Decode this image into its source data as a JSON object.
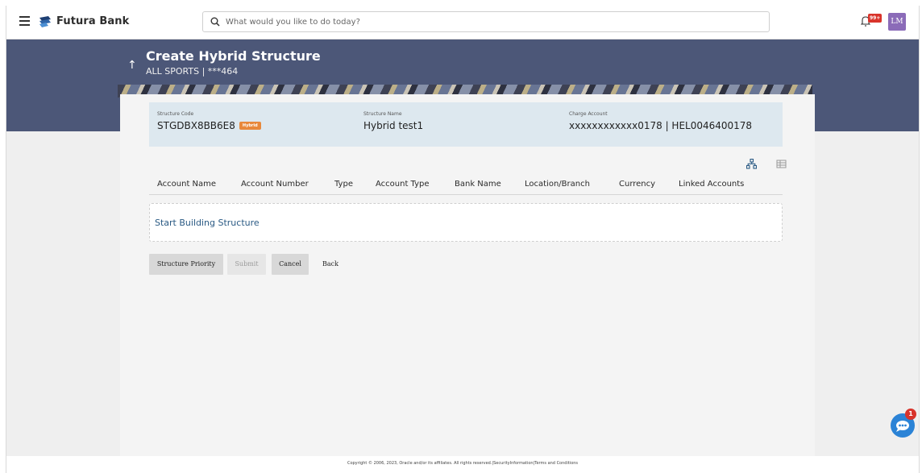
{
  "app": {
    "brand": "Futura Bank"
  },
  "search": {
    "placeholder": "What would you like to do today?"
  },
  "notifications": {
    "badge": "99+"
  },
  "user": {
    "initials": "LM"
  },
  "page": {
    "title": "Create Hybrid Structure",
    "subtitle": "ALL SPORTS | ***464"
  },
  "structure": {
    "code_label": "Structure Code",
    "code": "STGDBX8BB6E8",
    "tag": "Hybrid",
    "name_label": "Structure Name",
    "name": "Hybrid test1",
    "charge_label": "Charge Account",
    "charge": "xxxxxxxxxxxx0178 | HEL0046400178"
  },
  "table": {
    "columns": [
      "Account Name",
      "Account Number",
      "Type",
      "Account Type",
      "Bank Name",
      "Location/Branch",
      "Currency",
      "Linked Accounts"
    ],
    "empty_action": "Start Building Structure"
  },
  "actions": {
    "priority": "Structure Priority",
    "submit": "Submit",
    "cancel": "Cancel",
    "back": "Back"
  },
  "footer": {
    "text": "Copyright © 2006, 2023, Oracle and/or its affiliates. All rights reserved.|SecurityInformation|Terms and Conditions"
  },
  "chat": {
    "count": "1"
  },
  "colors": {
    "header": "#4c5778",
    "accent": "#e8883b",
    "link": "#2a5a84",
    "chat": "#2b83d6"
  }
}
